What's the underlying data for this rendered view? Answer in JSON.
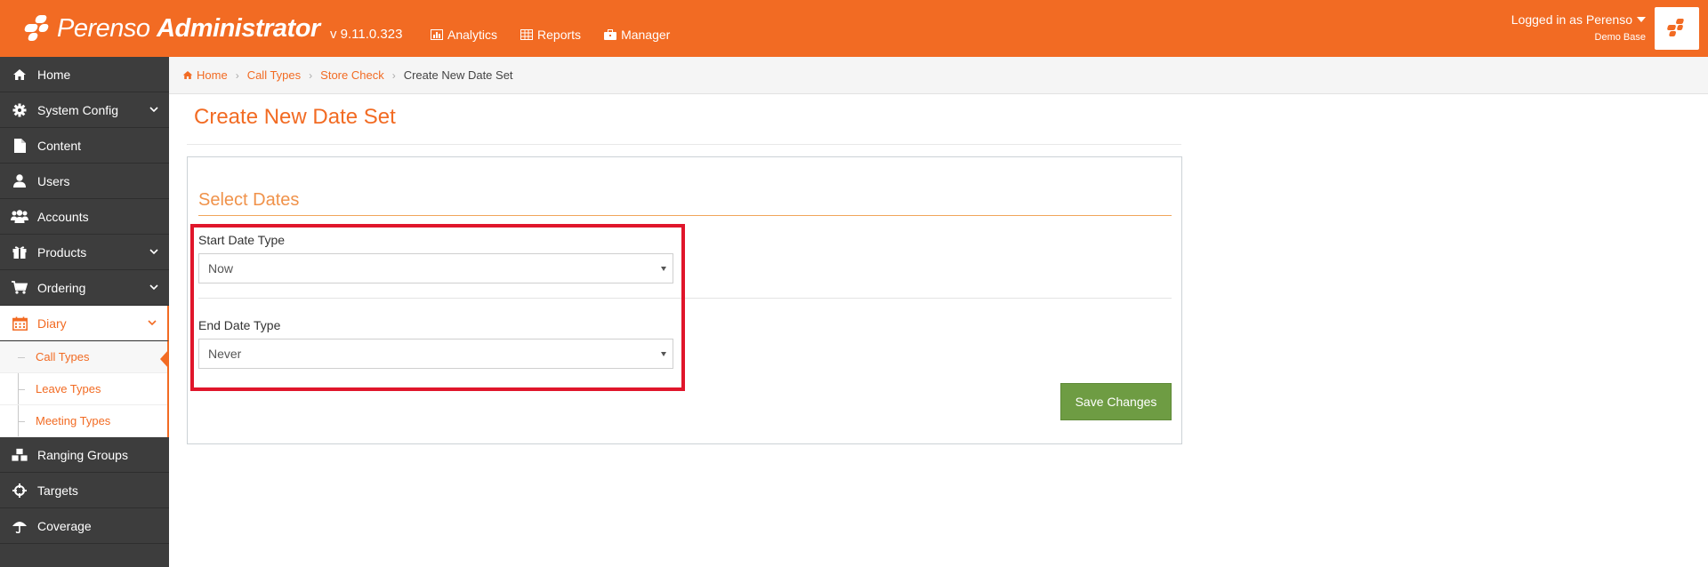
{
  "header": {
    "logo_light": "Perenso",
    "logo_bold": "Administrator",
    "version": "v 9.11.0.323",
    "nav": [
      {
        "label": "Analytics",
        "icon": "bar-chart-icon"
      },
      {
        "label": "Reports",
        "icon": "table-icon"
      },
      {
        "label": "Manager",
        "icon": "briefcase-icon"
      }
    ],
    "login_text": "Logged in as Perenso",
    "database": "Demo Base"
  },
  "sidebar": {
    "items": [
      {
        "label": "Home",
        "icon": "home-icon"
      },
      {
        "label": "System Config",
        "icon": "gear-icon"
      },
      {
        "label": "Content",
        "icon": "file-icon"
      },
      {
        "label": "Users",
        "icon": "user-icon"
      },
      {
        "label": "Accounts",
        "icon": "users-icon"
      },
      {
        "label": "Products",
        "icon": "gift-icon"
      },
      {
        "label": "Ordering",
        "icon": "cart-icon"
      },
      {
        "label": "Diary",
        "icon": "calendar-icon"
      }
    ],
    "diary_sub": [
      {
        "label": "Call Types"
      },
      {
        "label": "Leave Types"
      },
      {
        "label": "Meeting Types"
      }
    ],
    "items_after": [
      {
        "label": "Ranging Groups",
        "icon": "cubes-icon"
      },
      {
        "label": "Targets",
        "icon": "crosshairs-icon"
      },
      {
        "label": "Coverage",
        "icon": "umbrella-icon"
      }
    ]
  },
  "breadcrumb": {
    "home": "Home",
    "call_types": "Call Types",
    "store_check": "Store Check",
    "current": "Create New Date Set"
  },
  "page": {
    "title": "Create New Date Set",
    "section_title": "Select Dates",
    "start_label": "Start Date Type",
    "start_value": "Now",
    "end_label": "End Date Type",
    "end_value": "Never",
    "save_label": "Save Changes"
  },
  "colors": {
    "brand_orange": "#f26b23",
    "sidebar_dark": "#3d3d3d",
    "save_green": "#6e9c43",
    "highlight_red": "#e0162b"
  }
}
